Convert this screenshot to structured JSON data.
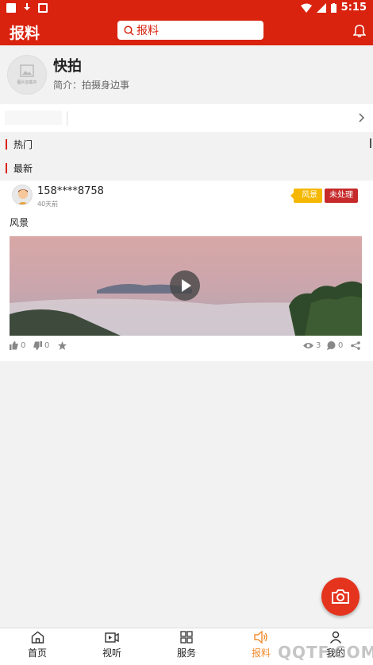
{
  "statusbar": {
    "time": "5:15"
  },
  "appbar": {
    "title": "报料",
    "search_text": "报料"
  },
  "profile": {
    "name": "快拍",
    "description": "简介：拍摄身边事",
    "avatar_caption": "图片加载中"
  },
  "sections": {
    "hot": "热门",
    "latest": "最新"
  },
  "post": {
    "username": "158****8758",
    "time": "40天前",
    "category_tag": "风景",
    "status_tag": "未处理",
    "title": "风景",
    "likes": "0",
    "dislikes": "0",
    "views": "3",
    "comments": "0"
  },
  "nav": [
    {
      "label": "首页",
      "icon": "home-icon"
    },
    {
      "label": "视听",
      "icon": "video-icon"
    },
    {
      "label": "服务",
      "icon": "grid-icon"
    },
    {
      "label": "报料",
      "icon": "speaker-icon",
      "active": true
    },
    {
      "label": "我的",
      "icon": "user-icon"
    }
  ],
  "watermark": "QQTF.COM",
  "colors": {
    "brand_red": "#d9230f",
    "active_orange": "#f28b2e",
    "category_yellow": "#f5b700",
    "status_red": "#c62a2a"
  }
}
